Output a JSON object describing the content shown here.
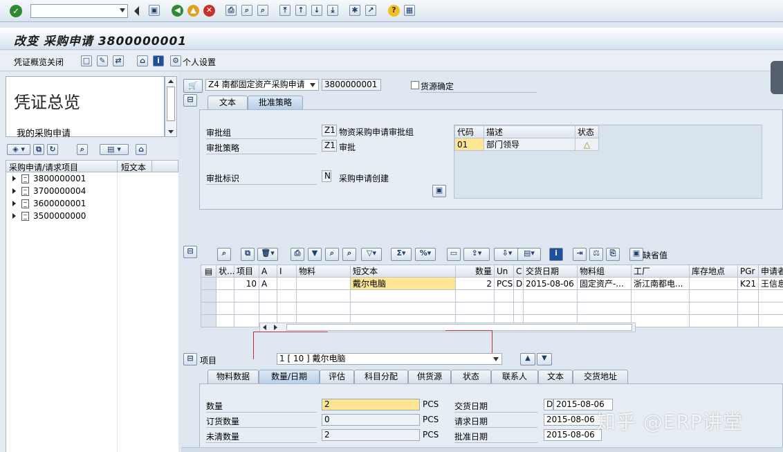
{
  "system_toolbar": {
    "command_field": ""
  },
  "title": "改变 采购申请 3800000001",
  "app_toolbar": {
    "close_overview": "凭证概览关闭",
    "personal_settings": "个人设置"
  },
  "overview": {
    "title": "凭证总览",
    "subtitle": "我的采购申请"
  },
  "tree": {
    "col1": "采购申请/请求项目",
    "col2": "短文本",
    "items": [
      "3800000001",
      "3700000004",
      "3600000001",
      "3500000000"
    ]
  },
  "header": {
    "doc_type": "Z4 南都固定资产采购申请",
    "doc_number": "3800000001",
    "source_confirm": "货源确定",
    "tabs": [
      "文本",
      "批准策略"
    ],
    "active_tab": 1
  },
  "approval": {
    "group_label": "审批组",
    "group_code": "Z1",
    "group_desc": "物资采购申请审批组",
    "strategy_label": "审批策略",
    "strategy_code": "Z1",
    "strategy_desc": "审批",
    "indicator_label": "审批标识",
    "indicator_code": "N",
    "indicator_desc": "采购申请创建",
    "table_headers": [
      "代码",
      "描述",
      "状态"
    ],
    "rows": [
      {
        "code": "01",
        "desc": "部门领导",
        "status": "△"
      }
    ]
  },
  "items_grid": {
    "headers": [
      "状...",
      "项目",
      "A",
      "I",
      "物料",
      "短文本",
      "数量",
      "Un",
      "C",
      "交货日期",
      "物料组",
      "工厂",
      "库存地点",
      "PGr",
      "申请者"
    ],
    "rows": [
      [
        "",
        "10",
        "A",
        "",
        "",
        "戴尔电脑",
        "2",
        "PCS",
        "D",
        "2015-08-06",
        "固定资产-...",
        "浙江南都电...",
        "",
        "K21",
        "王信息"
      ]
    ],
    "default_button": "缺省值"
  },
  "item_section": {
    "label": "项目",
    "selected": "1 [ 10 ] 戴尔电脑",
    "tabs": [
      "物料数据",
      "数量/日期",
      "评估",
      "科目分配",
      "供货源",
      "状态",
      "联系人",
      "文本",
      "交货地址"
    ],
    "active_tab": 1
  },
  "qty_date": {
    "qty_label": "数量",
    "qty": "2",
    "qty_unit": "PCS",
    "order_qty_label": "订货数量",
    "order_qty": "0",
    "order_unit": "PCS",
    "open_qty_label": "未清数量",
    "open_qty": "2",
    "open_unit": "PCS",
    "delivery_label": "交货日期",
    "delivery_cat": "D",
    "delivery_date": "2015-08-06",
    "request_label": "请求日期",
    "request_date": "2015-08-06",
    "release_label": "批准日期",
    "release_date": "2015-08-06"
  },
  "watermark": "知乎 @ERP讲堂"
}
